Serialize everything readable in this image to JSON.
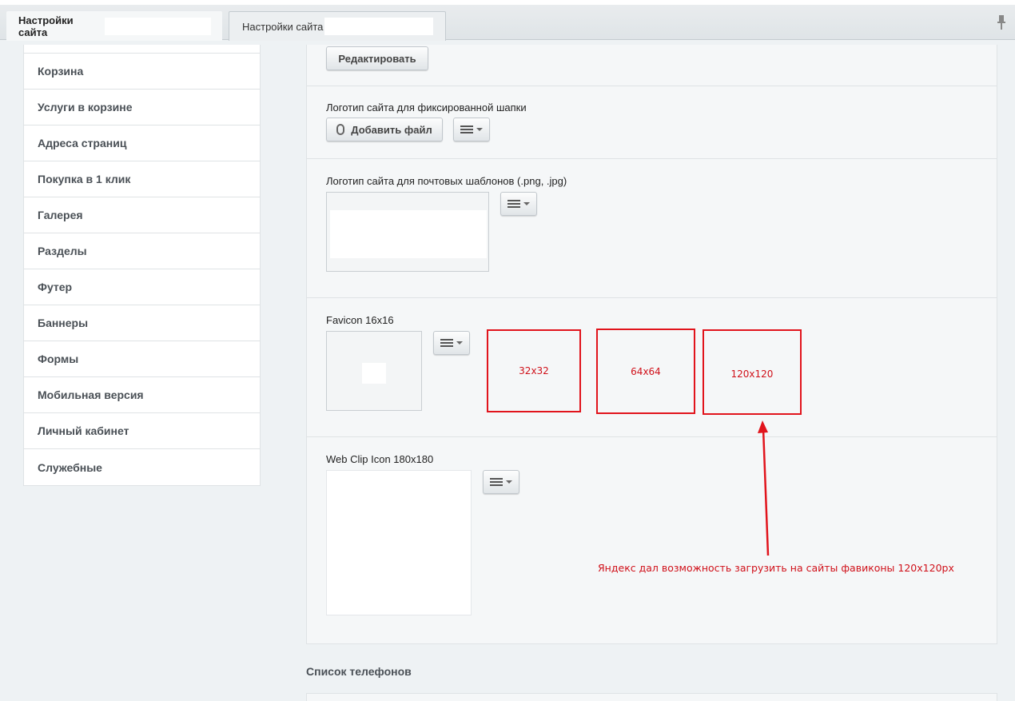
{
  "tabs": [
    {
      "label": "Настройки сайта"
    },
    {
      "label": "Настройки сайта"
    }
  ],
  "sidebar": {
    "items": [
      {
        "label": "Корзина"
      },
      {
        "label": "Услуги в корзине"
      },
      {
        "label": "Адреса страниц"
      },
      {
        "label": "Покупка в 1 клик"
      },
      {
        "label": "Галерея"
      },
      {
        "label": "Разделы"
      },
      {
        "label": "Футер"
      },
      {
        "label": "Баннеры"
      },
      {
        "label": "Формы"
      },
      {
        "label": "Мобильная версия"
      },
      {
        "label": "Личный кабинет"
      },
      {
        "label": "Служебные"
      }
    ]
  },
  "main": {
    "edit_button": "Редактировать",
    "fixed_header_logo": {
      "label": "Логотип сайта для фиксированной шапки",
      "add_file_button": "Добавить файл"
    },
    "mail_logo": {
      "label": "Логотип сайта для почтовых шаблонов (.png, .jpg)"
    },
    "favicon": {
      "label": "Favicon 16x16"
    },
    "webclip": {
      "label": "Web Clip Icon 180x180"
    },
    "phones_title": "Список телефонов"
  },
  "annotations": {
    "boxes": [
      "32x32",
      "64x64",
      "120x120"
    ],
    "note": "Яндекс дал возможность загрузить на сайты фавиконы 120x120px",
    "color": "#e1141c"
  },
  "icons": [
    "pin-icon",
    "paperclip-icon",
    "menu-icon"
  ]
}
